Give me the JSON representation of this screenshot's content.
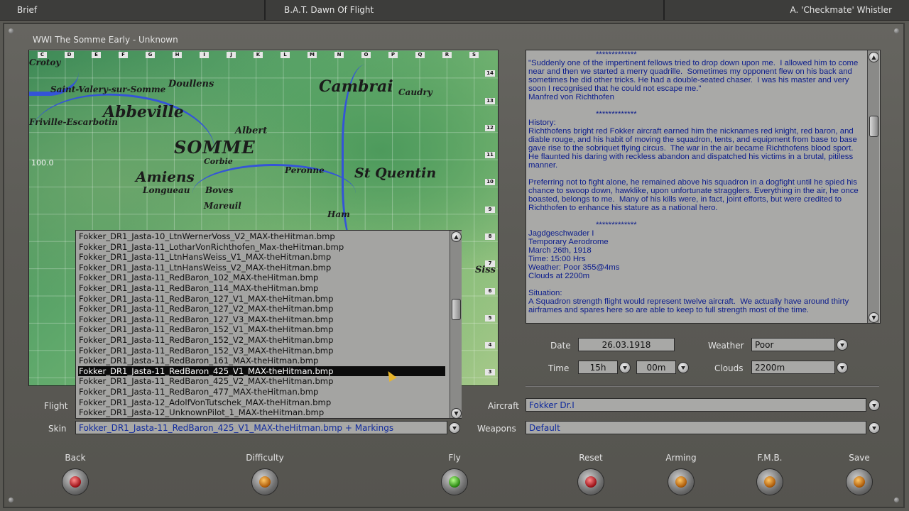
{
  "topbar": {
    "left": "Brief",
    "center": "B.A.T. Dawn Of Flight",
    "right": "A. 'Checkmate' Whistler"
  },
  "mission": {
    "title": "WWI The Somme Early - Unknown"
  },
  "map": {
    "zoom": "100.0",
    "columns": [
      "C",
      "D",
      "E",
      "F",
      "G",
      "H",
      "I",
      "J",
      "K",
      "L",
      "M",
      "N",
      "O",
      "P",
      "Q",
      "R",
      "S"
    ],
    "rows": [
      "14",
      "13",
      "12",
      "11",
      "10",
      "9",
      "8",
      "7",
      "6",
      "5",
      "4",
      "3"
    ],
    "towns": {
      "abbeville": "Abbeville",
      "somme": "SOMME",
      "amiens": "Amiens",
      "cambrai": "Cambrai",
      "st_quentin": "St Quentin",
      "albert": "Albert",
      "peronne": "Peronne",
      "doullens": "Doullens",
      "longueau": "Longueau",
      "boves": "Boves",
      "mareuil": "Mareuil",
      "corbie": "Corbie",
      "caudry": "Caudry",
      "friville": "Friville-Escarbotin",
      "st_valery": "Saint-Valery-sur-Somme",
      "crotoy": "Crotoy",
      "ham": "Ham",
      "sissonne": "Siss"
    }
  },
  "skins": {
    "selected_index": 13,
    "items": [
      "Fokker_DR1_Jasta-10_LtnWernerVoss_V2_MAX-theHitman.bmp",
      "Fokker_DR1_Jasta-11_LotharVonRichthofen_Max-theHitman.bmp",
      "Fokker_DR1_Jasta-11_LtnHansWeiss_V1_MAX-theHitman.bmp",
      "Fokker_DR1_Jasta-11_LtnHansWeiss_V2_MAX-theHitman.bmp",
      "Fokker_DR1_Jasta-11_RedBaron_102_MAX-theHitman.bmp",
      "Fokker_DR1_Jasta-11_RedBaron_114_MAX-theHitman.bmp",
      "Fokker_DR1_Jasta-11_RedBaron_127_V1_MAX-theHitman.bmp",
      "Fokker_DR1_Jasta-11_RedBaron_127_V2_MAX-theHitman.bmp",
      "Fokker_DR1_Jasta-11_RedBaron_127_V3_MAX-theHitman.bmp",
      "Fokker_DR1_Jasta-11_RedBaron_152_V1_MAX-theHitman.bmp",
      "Fokker_DR1_Jasta-11_RedBaron_152_V2_MAX-theHitman.bmp",
      "Fokker_DR1_Jasta-11_RedBaron_152_V3_MAX-theHitman.bmp",
      "Fokker_DR1_Jasta-11_RedBaron_161_MAX-theHitman.bmp",
      "Fokker_DR1_Jasta-11_RedBaron_425_V1_MAX-theHitman.bmp",
      "Fokker_DR1_Jasta-11_RedBaron_425_V2_MAX-theHitman.bmp",
      "Fokker_DR1_Jasta-11_RedBaron_477_MAX-theHitman.bmp",
      "Fokker_DR1_Jasta-12_AdolfVonTutschek_MAX-theHitman.bmp",
      "Fokker_DR1_Jasta-12_UnknownPilot_1_MAX-theHitman.bmp"
    ]
  },
  "brief": {
    "text": "                              *************\n\"Suddenly one of the impertinent fellows tried to drop down upon me.  I allowed him to come near and then we started a merry quadrille.  Sometimes my opponent flew on his back and sometimes he did other tricks. He had a double-seated chaser.  I was his master and very soon I recognised that he could not escape me.\"\nManfred von Richthofen\n\n                              *************\nHistory:\nRichthofens bright red Fokker aircraft earned him the nicknames red knight, red baron, and diable rouge, and his habit of moving the squadron, tents, and equipment from base to base gave rise to the sobriquet flying circus.  The war in the air became Richthofens blood sport.  He flaunted his daring with reckless abandon and dispatched his victims in a brutal, pitiless manner.\n\nPreferring not to fight alone, he remained above his squadron in a dogfight until he spied his chance to swoop down, hawklike, upon unfortunate stragglers. Everything in the air, he once boasted, belongs to me.  Many of his kills were, in fact, joint efforts, but were credited to Richthofen to enhance his stature as a national hero.\n\n                              *************\nJagdgeschwader I\nTemporary Aerodrome\nMarch 26th, 1918\nTime: 15:00 Hrs\nWeather: Poor 355@4ms\nClouds at 2200m\n\nSituation:\nA Squadron strength flight would represent twelve aircraft.  We actually have around thirty airframes and spares here so are able to keep to full strength most of the time."
  },
  "labels": {
    "date": "Date",
    "time": "Time",
    "weather": "Weather",
    "clouds": "Clouds",
    "flight": "Flight",
    "skin": "Skin",
    "aircraft": "Aircraft",
    "weapons": "Weapons"
  },
  "values": {
    "date": "26.03.1918",
    "hour": "15h",
    "minute": "00m",
    "weather": "Poor",
    "clouds": "2200m",
    "skin": "Fokker_DR1_Jasta-11_RedBaron_425_V1_MAX-theHitman.bmp + Markings",
    "aircraft": "Fokker Dr.I",
    "weapons": "Default"
  },
  "buttons": {
    "back": "Back",
    "difficulty": "Difficulty",
    "fly": "Fly",
    "reset": "Reset",
    "arming": "Arming",
    "fmb": "F.M.B.",
    "save": "Save"
  },
  "colors": {
    "accent_text": "#102a9c",
    "lamp_red": "#a0141a",
    "lamp_amber": "#b05e0b",
    "lamp_green": "#2d8b14"
  }
}
